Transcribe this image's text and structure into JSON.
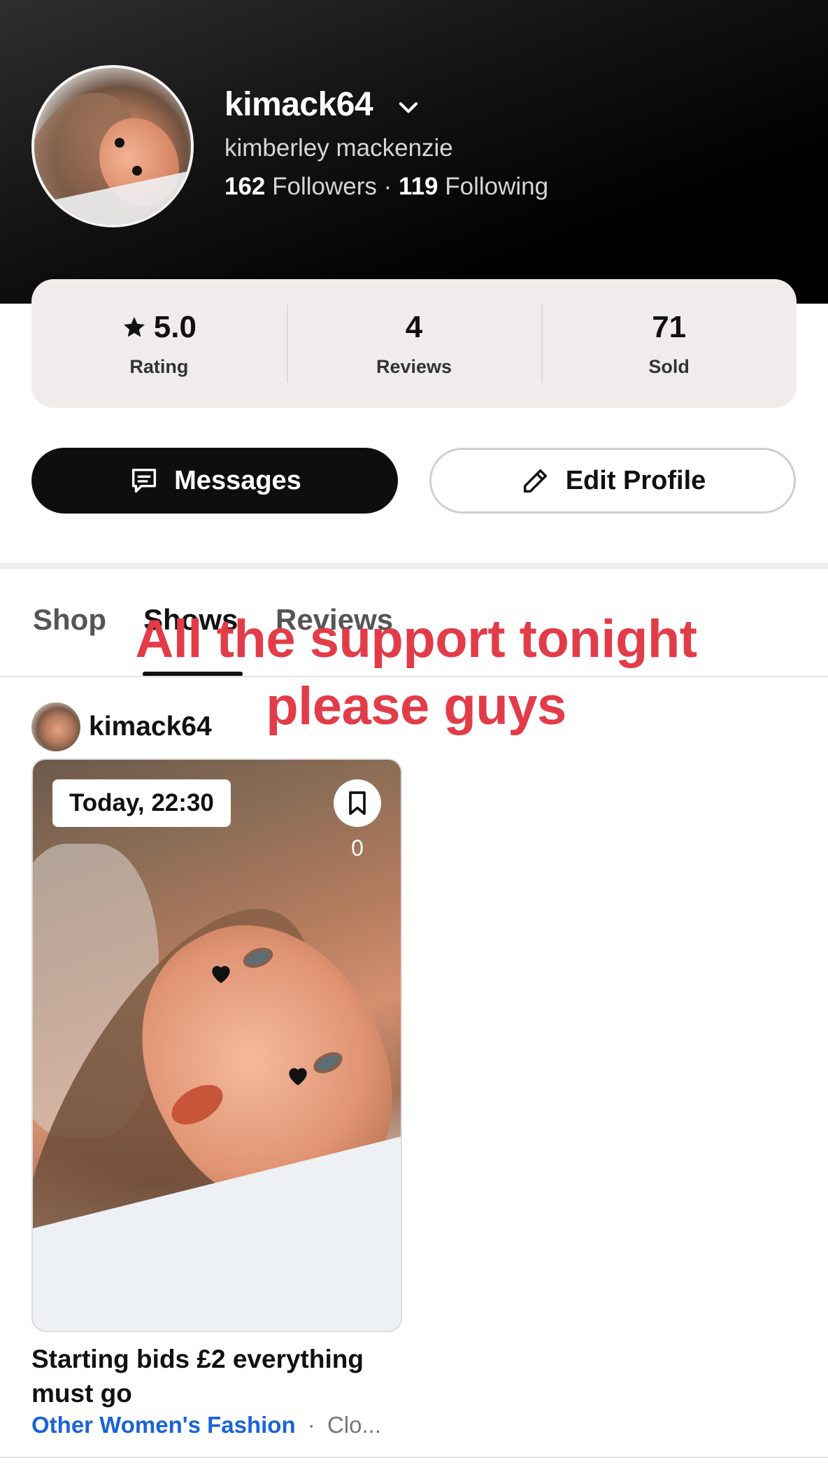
{
  "profile": {
    "username": "kimack64",
    "full_name": "kimberley mackenzie",
    "followers_count": "162",
    "followers_label": "Followers",
    "separator": "·",
    "following_count": "119",
    "following_label": "Following"
  },
  "stats": [
    {
      "value": "5.0",
      "label": "Rating",
      "icon": "star-icon"
    },
    {
      "value": "4",
      "label": "Reviews"
    },
    {
      "value": "71",
      "label": "Sold"
    }
  ],
  "actions": {
    "messages_label": "Messages",
    "edit_profile_label": "Edit Profile"
  },
  "tabs": [
    {
      "label": "Shop"
    },
    {
      "label": "Shows",
      "active": true
    },
    {
      "label": "Reviews"
    }
  ],
  "overlay_text": "All the support tonight please guys",
  "show": {
    "seller": "kimack64",
    "time": "Today, 22:30",
    "bookmark_count": "0",
    "title": "Starting bids £2 everything must go",
    "category": "Other Women's Fashion",
    "separator": "·",
    "subcategory": "Clo..."
  },
  "colors": {
    "header_bg": "#000000",
    "accent_red": "#e23c48",
    "category_blue": "#1a63d8",
    "stats_bg": "#efeceb",
    "messages_bg": "#0e0e0e"
  }
}
